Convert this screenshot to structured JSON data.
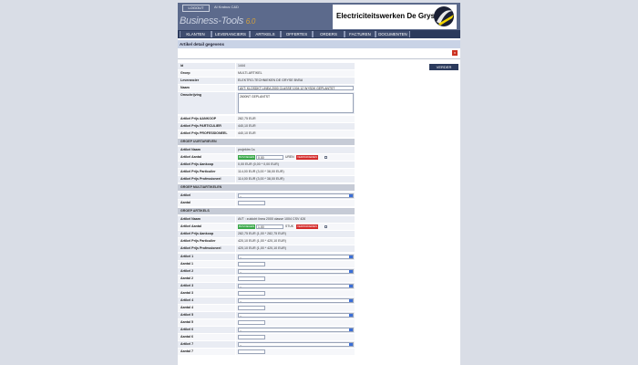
{
  "header": {
    "logout_label": "LOGOUT",
    "user_info": "Al Krabus C&D",
    "brand": "Business-Tools",
    "brand_version": "6.0",
    "company_logo_text": "Electriciteitswerken De Gryse",
    "colors": {
      "header_bg": "#5c6a8c",
      "nav_bg": "#2b3a5c",
      "accent_green": "#3aa84a",
      "accent_red": "#d42b2b"
    }
  },
  "nav": {
    "items": [
      {
        "label": "KLANTEN"
      },
      {
        "label": "LEVERANCIERS"
      },
      {
        "label": "ARTIKELS"
      },
      {
        "label": "OFFERTES"
      },
      {
        "label": "ORDERS"
      },
      {
        "label": "FACTUREN"
      },
      {
        "label": "DOCUMENTEN"
      }
    ]
  },
  "page": {
    "title": "Artikel detail gegevens",
    "verder_label": "VERDER",
    "close_label": "x"
  },
  "form": {
    "id": {
      "label": "Id",
      "value": "1444"
    },
    "groep": {
      "label": "Groep",
      "value": "MULTI-ARTIKEL"
    },
    "leverancier": {
      "label": "Leverancier",
      "value": "ELEKTRO-TECHNIEKEN DE GRYSE BVBA"
    },
    "naam": {
      "label": "Naam",
      "value": "AVT: KLOSDKT LINEA 2000 CLASSE 1004 12 W+SDK GEPLANTST"
    },
    "omschrijving": {
      "label": "Omschrijving",
      "value": "2600NT GEPLANTST"
    },
    "prijs_aankoop": {
      "label": "Artikel Prijs AANKOOP",
      "value": "282,75 EUR"
    },
    "prijs_particulier": {
      "label": "Artikel Prijs PARTICULIER",
      "value": "440,10 EUR"
    },
    "prijs_professioneel": {
      "label": "Artikel Prijs PROFESSIONEEL",
      "value": "440,10 EUR"
    },
    "uurtarieven": {
      "section": "GROEP UURTARIEVEN",
      "naam": {
        "label": "Artikel Naam",
        "value": "projektm 1s"
      },
      "aantal": {
        "label": "Artikel Aantal",
        "add_label": "BIJVOEGEN",
        "value": "0,00",
        "unit": "UREN",
        "remove_label": "VERWIJDEREN"
      },
      "prijs_aankoop": {
        "label": "Artikel Prijs Aankoop",
        "value": "0,00 EUR (0,00 * 0,00 EUR)"
      },
      "prijs_particulier": {
        "label": "Artikel Prijs Particulier",
        "value": "114,00 EUR (3,00 * 38,00 EUR)"
      },
      "prijs_professioneel": {
        "label": "Artikel Prijs Professioneel",
        "value": "114,00 EUR (3,00 * 38,00 EUR)"
      }
    },
    "multiartikels": {
      "section": "GROEP MULTIARTIKELEN",
      "artikel": {
        "label": "Artikel",
        "value": "--"
      },
      "aantal": {
        "label": "Aantal",
        "value": ""
      }
    },
    "artikels": {
      "section": "GROEP ARTIKELS",
      "naam": {
        "label": "Artikel Naam",
        "value": "AVT : zuidoht linea 2000 classe 1004 CSV 426"
      },
      "aantal": {
        "label": "Artikel Aantal",
        "add_label": "BIJVOEGEN",
        "value": "1,00",
        "unit": "STUK",
        "remove_label": "VERWIJDEREN"
      },
      "prijs_aankoop": {
        "label": "Artikel Prijs Aankoop",
        "value": "282,75 EUR (1,00 * 282,75 EUR)"
      },
      "prijs_particulier": {
        "label": "Artikel Prijs Particulier",
        "value": "420,10 EUR (1,00 * 420,10 EUR)"
      },
      "prijs_professioneel": {
        "label": "Artikel Prijs Professioneel",
        "value": "420,10 EUR (1,00 * 420,10 EUR)"
      }
    },
    "extra_rows": [
      {
        "label": "Artikel 1",
        "type": "select",
        "value": "--"
      },
      {
        "label": "Aantal 1",
        "type": "input",
        "value": ""
      },
      {
        "label": "Artikel 2",
        "type": "select",
        "value": "--"
      },
      {
        "label": "Aantal 2",
        "type": "input",
        "value": ""
      },
      {
        "label": "Artikel 3",
        "type": "select",
        "value": "--"
      },
      {
        "label": "Aantal 3",
        "type": "input",
        "value": ""
      },
      {
        "label": "Artikel 4",
        "type": "select",
        "value": "--"
      },
      {
        "label": "Aantal 4",
        "type": "input",
        "value": ""
      },
      {
        "label": "Artikel 5",
        "type": "select",
        "value": "--"
      },
      {
        "label": "Aantal 5",
        "type": "input",
        "value": ""
      },
      {
        "label": "Artikel 6",
        "type": "select",
        "value": "--"
      },
      {
        "label": "Aantal 6",
        "type": "input",
        "value": ""
      },
      {
        "label": "Artikel 7",
        "type": "select",
        "value": "--"
      },
      {
        "label": "Aantal 7",
        "type": "input",
        "value": ""
      }
    ]
  }
}
